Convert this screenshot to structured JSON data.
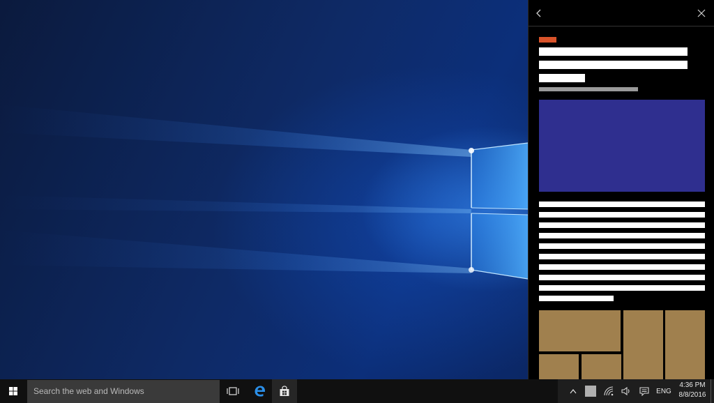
{
  "taskbar": {
    "search_placeholder": "Search the web and Windows",
    "language": "ENG",
    "clock": {
      "time": "4:36 PM",
      "date": "8/8/2016"
    }
  },
  "panel": {
    "header_icons": [
      "back-arrow-icon",
      "close-icon"
    ],
    "body_line_count": 11,
    "tiles": 6
  },
  "colors": {
    "accent_tag": "#d9532a",
    "hero_image": "#2f2f8f",
    "tiles": "#a0804e",
    "taskbar": "#101010",
    "search_box": "#3a3a3a",
    "edge_blue": "#2b8fe8"
  }
}
